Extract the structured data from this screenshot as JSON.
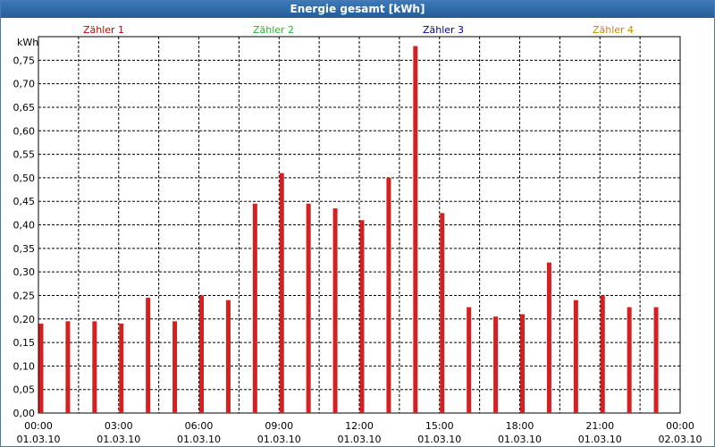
{
  "window": {
    "title": "Energie gesamt [kWh]"
  },
  "legend": [
    {
      "label": "Zähler 1",
      "color": "#cc0000"
    },
    {
      "label": "Zähler 2",
      "color": "#22bb22"
    },
    {
      "label": "Zähler 3",
      "color": "#000099"
    },
    {
      "label": "Zähler 4",
      "color": "#cc8800"
    }
  ],
  "chart_data": {
    "type": "bar",
    "title": "Energie gesamt [kWh]",
    "ylabel": "kWh",
    "ylim": [
      0,
      0.8
    ],
    "yticks": [
      "0,00",
      "0,05",
      "0,10",
      "0,15",
      "0,20",
      "0,25",
      "0,30",
      "0,35",
      "0,40",
      "0,45",
      "0,50",
      "0,55",
      "0,60",
      "0,65",
      "0,70",
      "0,75"
    ],
    "xlim_hours": [
      0,
      24
    ],
    "xticks": [
      {
        "time": "00:00",
        "date": "01.03.10"
      },
      {
        "time": "03:00",
        "date": "01.03.10"
      },
      {
        "time": "06:00",
        "date": "01.03.10"
      },
      {
        "time": "09:00",
        "date": "01.03.10"
      },
      {
        "time": "12:00",
        "date": "01.03.10"
      },
      {
        "time": "15:00",
        "date": "01.03.10"
      },
      {
        "time": "18:00",
        "date": "01.03.10"
      },
      {
        "time": "21:00",
        "date": "01.03.10"
      },
      {
        "time": "00:00",
        "date": "02.03.10"
      }
    ],
    "grid": true,
    "bar_color": "#d42020",
    "series": [
      {
        "name": "Zähler 1",
        "x": [
          "00:00",
          "01:00",
          "02:00",
          "03:00",
          "04:00",
          "05:00",
          "06:00",
          "07:00",
          "08:00",
          "09:00",
          "10:00",
          "11:00",
          "12:00",
          "13:00",
          "14:00",
          "15:00",
          "16:00",
          "17:00",
          "18:00",
          "19:00",
          "20:00",
          "21:00",
          "22:00",
          "23:00"
        ],
        "values": [
          0.19,
          0.195,
          0.195,
          0.19,
          0.245,
          0.195,
          0.25,
          0.24,
          0.445,
          0.51,
          0.445,
          0.435,
          0.41,
          0.5,
          0.78,
          0.425,
          0.225,
          0.205,
          0.21,
          0.32,
          0.24,
          0.25,
          0.225,
          0.225
        ]
      }
    ]
  }
}
